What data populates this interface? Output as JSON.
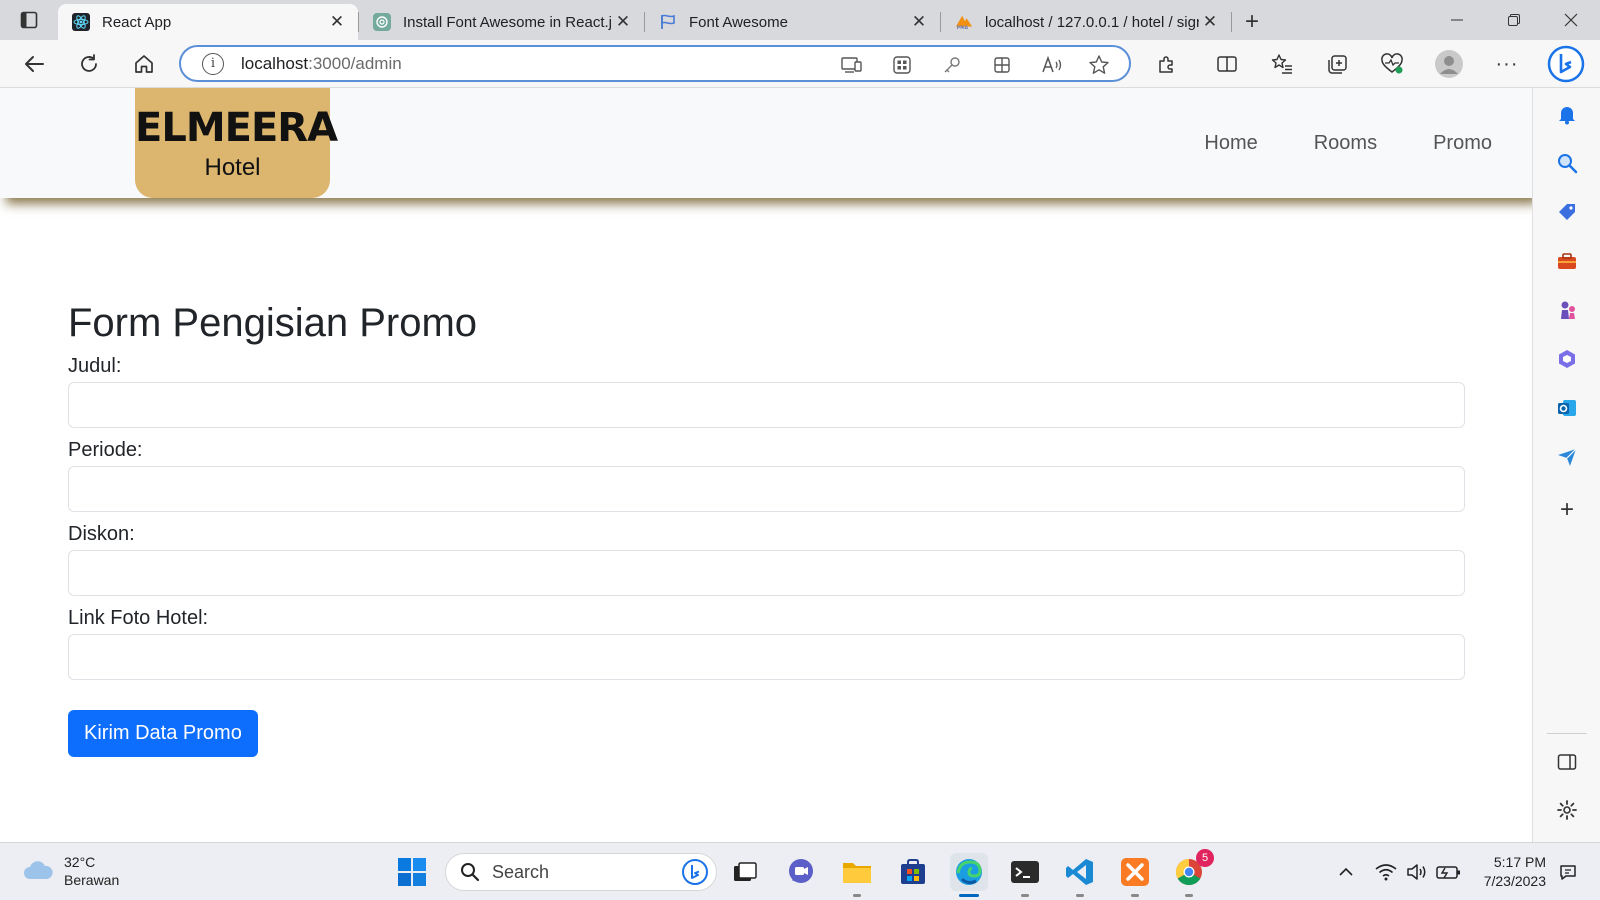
{
  "browser": {
    "tabs": [
      {
        "title": "React App",
        "active": true
      },
      {
        "title": "Install Font Awesome in React.js",
        "active": false
      },
      {
        "title": "Font Awesome",
        "active": false
      },
      {
        "title": "localhost / 127.0.0.1 / hotel / sign",
        "active": false
      }
    ],
    "url_host": "localhost",
    "url_path": ":3000/admin"
  },
  "site": {
    "brand": "ELMEERA",
    "brand_sub": "Hotel",
    "nav": [
      "Home",
      "Rooms",
      "Promo"
    ]
  },
  "form": {
    "title": "Form Pengisian Promo",
    "fields": [
      {
        "label": "Judul:",
        "value": ""
      },
      {
        "label": "Periode:",
        "value": ""
      },
      {
        "label": "Diskon:",
        "value": ""
      },
      {
        "label": "Link Foto Hotel:",
        "value": ""
      }
    ],
    "submit_label": "Kirim Data Promo"
  },
  "taskbar": {
    "temperature": "32°C",
    "weather": "Berawan",
    "search_label": "Search",
    "time": "5:17 PM",
    "date": "7/23/2023",
    "chrome_badge": "5"
  },
  "colors": {
    "logo_bg": "#dcb66e",
    "primary_button": "#0d6efd",
    "omnibox_border": "#5b8fd8"
  }
}
